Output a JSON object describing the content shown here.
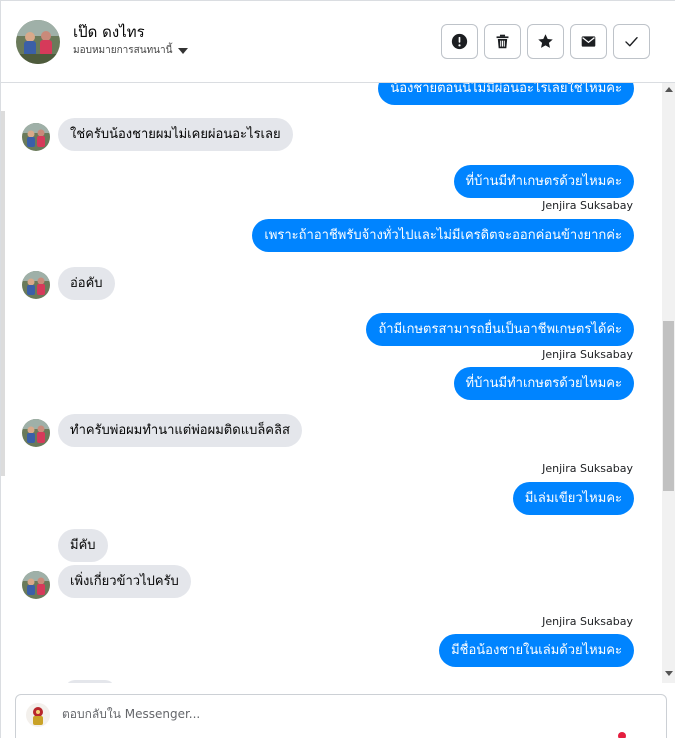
{
  "contact": {
    "name": "เป๊ด ดงไทร",
    "assign_label": "มอบหมายการสนทนานี้"
  },
  "actions": [
    {
      "name": "report-icon"
    },
    {
      "name": "trash-icon"
    },
    {
      "name": "star-icon"
    },
    {
      "name": "envelope-icon"
    },
    {
      "name": "check-icon"
    }
  ],
  "messages": [
    {
      "dir": "out",
      "text": "น้องชายตอนนี้ไม่มีผ่อนอะไรเลยใช่ไหมคะ"
    },
    {
      "dir": "in",
      "text": "ใช่ครับน้องชายผมไม่เคยผ่อนอะไรเลย"
    },
    {
      "dir": "out",
      "text": "ที่บ้านมีทำเกษตรด้วยไหมคะ"
    },
    {
      "dir": "out",
      "sender": "Jenjira Suksabay",
      "text": "เพราะถ้าอาชีพรับจ้างทั่วไปและไม่มีเครดิตจะออกค่อนข้างยากค่ะ"
    },
    {
      "dir": "in",
      "text": "อ่อคับ"
    },
    {
      "dir": "out",
      "text": "ถ้ามีเกษตรสามารถยื่นเป็นอาชีพเกษตรได้ค่ะ"
    },
    {
      "dir": "out",
      "sender": "Jenjira Suksabay",
      "text": "ที่บ้านมีทำเกษตรด้วยไหมคะ"
    },
    {
      "dir": "in",
      "text": "ทำครับพ่อผมทำนาแต่พ่อผมติดแบล็คลิส"
    },
    {
      "dir": "out",
      "sender": "Jenjira Suksabay",
      "text": "มีเล่มเขียวไหมคะ"
    },
    {
      "dir": "in",
      "text": "มีคับ"
    },
    {
      "dir": "in",
      "text": "เพิ่งเกี่ยวข้าวไปครับ"
    },
    {
      "dir": "out",
      "sender": "Jenjira Suksabay",
      "text": "มีชื่อน้องชายในเล่มด้วยไหมคะ"
    }
  ],
  "composer": {
    "placeholder": "ตอบกลับใน Messenger..."
  },
  "colors": {
    "outgoing": "#0084ff",
    "incoming": "#e4e6eb",
    "notification": "#e41e3f"
  }
}
